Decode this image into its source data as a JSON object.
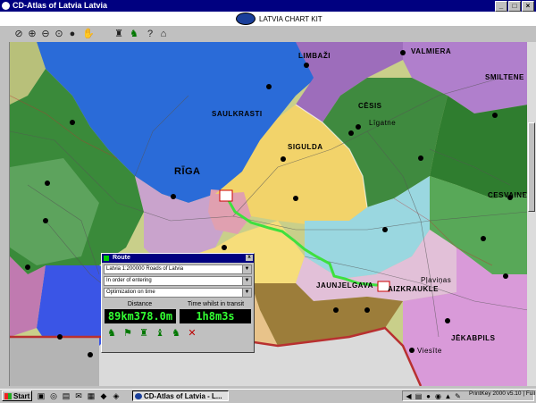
{
  "window": {
    "title": "CD-Atlas of Latvia   Latvia",
    "controls": [
      "_",
      "□",
      "×"
    ]
  },
  "header": {
    "brand": "LATVIA CHART KIT"
  },
  "toolbar": {
    "tools": [
      "zoom-select-icon",
      "zoom-in-icon",
      "zoom-out-icon",
      "zoom-fit-icon",
      "globe-icon",
      "hand-icon",
      "walker-icon",
      "route-icon",
      "help-icon",
      "info-icon"
    ]
  },
  "map": {
    "labels": {
      "riga": "RĪGA",
      "saulkrasti": "SAULKRASTI",
      "limbazi": "LIMBAŽI",
      "valmiera": "VALMIERA",
      "smiltene": "SMILTENE",
      "cesis": "CĒSIS",
      "ligatne": "Līgatne",
      "sigulda": "SIGULDA",
      "cesvaine": "CESVAINE",
      "jaunjelgava": "JAUNJELGAVA",
      "plavinas": "Pļaviņas",
      "aizkraukle": "AIZKRAUKLE",
      "jekabpils": "JĒKABPILS",
      "viesite": "Viesīte"
    },
    "route_color": "#3ee03e"
  },
  "route_panel": {
    "title": "Route",
    "map_select": "Latvia  1:200000 Roads of Latvia",
    "order_select": "In order of entering",
    "optimization_select": "Optimization on time",
    "distance_label": "Distance",
    "time_label": "Time whilst in transit",
    "distance_value": "89km378.0m",
    "time_value": "1h8m3s"
  },
  "taskbar": {
    "start": "Start",
    "task": "CD-Atlas of Latvia - L...",
    "tray_text": "PrintKey 2000  v5.10 | Full"
  }
}
